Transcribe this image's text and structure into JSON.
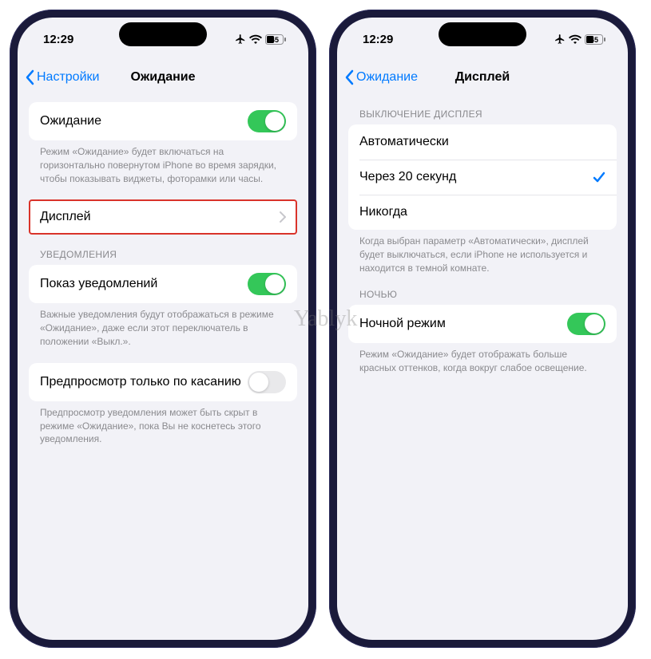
{
  "watermark": "Yablyk",
  "status": {
    "time": "12:29",
    "battery": "45"
  },
  "left": {
    "back_label": "Настройки",
    "title": "Ожидание",
    "standby": {
      "label": "Ожидание",
      "footer": "Режим «Ожидание» будет включаться на горизонтально повернутом iPhone во время зарядки, чтобы показывать виджеты, фоторамки или часы."
    },
    "display_row": {
      "label": "Дисплей"
    },
    "notifications_header": "УВЕДОМЛЕНИЯ",
    "show_notifications": {
      "label": "Показ уведомлений",
      "footer": "Важные уведомления будут отображаться в режиме «Ожидание», даже если этот переключатель в положении «Выкл.»."
    },
    "preview_touch": {
      "label": "Предпросмотр только по касанию",
      "footer": "Предпросмотр уведомления может быть скрыт в режиме «Ожидание», пока Вы не коснетесь этого уведомления."
    }
  },
  "right": {
    "back_label": "Ожидание",
    "title": "Дисплей",
    "off_header": "ВЫКЛЮЧЕНИЕ ДИСПЛЕЯ",
    "options": {
      "auto": "Автоматически",
      "after20": "Через 20 секунд",
      "never": "Никогда"
    },
    "off_footer": "Когда выбран параметр «Автоматически», дисплей будет выключаться, если iPhone не используется и находится в темной комнате.",
    "night_header": "НОЧЬЮ",
    "night_mode": {
      "label": "Ночной режим",
      "footer": "Режим «Ожидание» будет отображать больше красных оттенков, когда вокруг слабое освещение."
    }
  }
}
